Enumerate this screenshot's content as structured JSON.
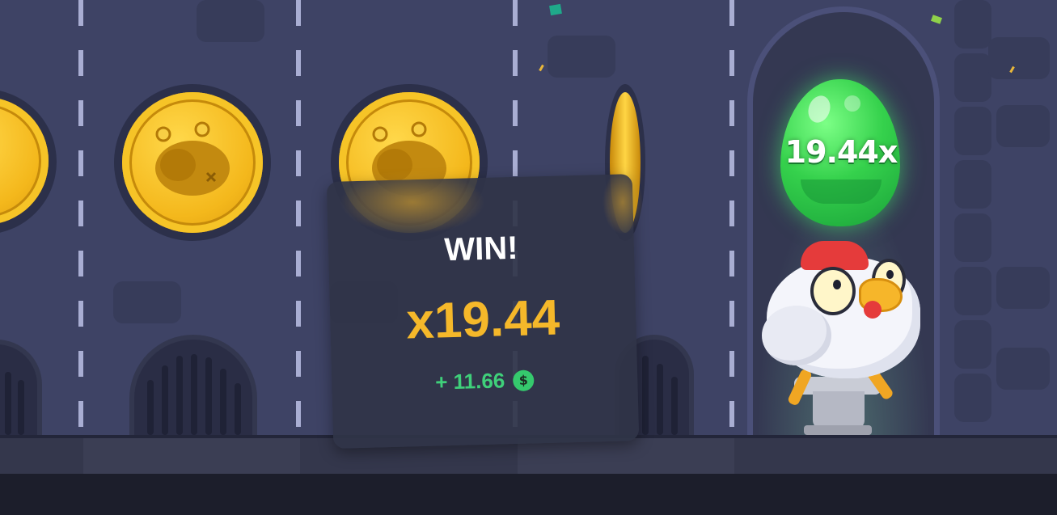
{
  "game": {
    "egg_multiplier_label": "19.44x"
  },
  "win_popup": {
    "title": "WIN!",
    "multiplier": "x19.44",
    "payout": "+ 11.66",
    "currency_symbol": "$"
  },
  "colors": {
    "background": "#3e4365",
    "multiplier_gold": "#f5b82a",
    "payout_green": "#3fd07a",
    "egg_green": "#35d14c"
  }
}
